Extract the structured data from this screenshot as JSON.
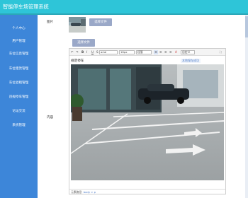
{
  "app": {
    "title": "智能停车场管理系统"
  },
  "sidebar": {
    "items": [
      {
        "label": "个人中心"
      },
      {
        "label": "用户管理"
      },
      {
        "label": "车位信息管理"
      },
      {
        "label": "车位租赁管理"
      },
      {
        "label": "车位退租管理"
      },
      {
        "label": "违规停车管理"
      },
      {
        "label": "论坛交流"
      },
      {
        "label": "系统管理"
      }
    ]
  },
  "form": {
    "image_label": "图片",
    "upload_image_button": "选择文件",
    "upload_file_button": "选择文件",
    "content_label": "内容"
  },
  "editor": {
    "toolbar": {
      "bold": "B",
      "italic": "I",
      "underline": "U",
      "font_family": "arial",
      "font_size": "16px",
      "paragraph": "段落",
      "font_color": "A",
      "more": "自定义"
    },
    "caption": "规范停车",
    "float_button": "本地保存成功",
    "status_prefix": "元素路径:",
    "status_path": "body > p"
  },
  "colors": {
    "header": "#2ec5d8",
    "sidebar": "#3d86d9",
    "button": "#9aa8c8"
  },
  "icons": {
    "undo": "undo-icon",
    "redo": "redo-icon",
    "align": "align-icon",
    "fullscreen": "fullscreen-icon"
  }
}
